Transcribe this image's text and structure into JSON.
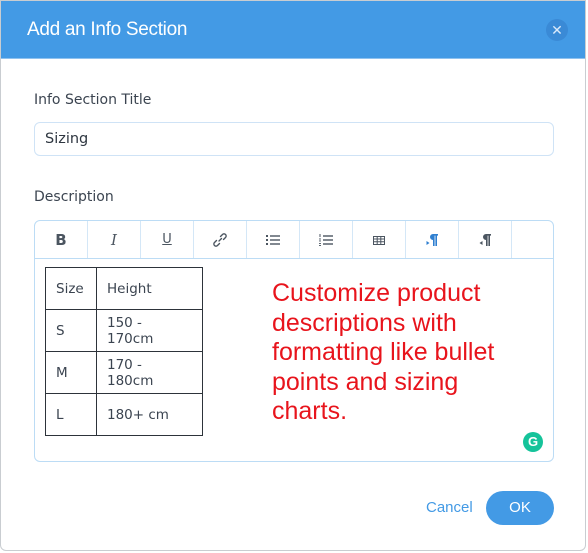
{
  "dialog": {
    "title": "Add an Info Section",
    "close_icon": "close-icon"
  },
  "form": {
    "title_label": "Info Section Title",
    "title_value": "Sizing",
    "description_label": "Description"
  },
  "toolbar": {
    "buttons": [
      {
        "name": "bold",
        "icon": "bold-icon"
      },
      {
        "name": "italic",
        "icon": "italic-icon"
      },
      {
        "name": "underline",
        "icon": "underline-icon"
      },
      {
        "name": "link",
        "icon": "link-icon"
      },
      {
        "name": "bulleted-list",
        "icon": "bullet-list-icon"
      },
      {
        "name": "numbered-list",
        "icon": "numbered-list-icon"
      },
      {
        "name": "table",
        "icon": "table-icon"
      },
      {
        "name": "text-direction-ltr",
        "icon": "ltr-paragraph-icon"
      },
      {
        "name": "text-direction-rtl",
        "icon": "rtl-paragraph-icon"
      }
    ],
    "bold_glyph": "B",
    "italic_glyph": "I",
    "underline_glyph": "U"
  },
  "size_table": {
    "headers": [
      "Size",
      "Height"
    ],
    "rows": [
      [
        "S",
        "150 - 170cm"
      ],
      [
        "M",
        "170 - 180cm"
      ],
      [
        "L",
        "180+ cm"
      ]
    ]
  },
  "annotation": "Customize product descriptions with formatting like bullet points and sizing charts.",
  "grammarly_glyph": "G",
  "footer": {
    "cancel_label": "Cancel",
    "ok_label": "OK"
  },
  "colors": {
    "accent": "#439ae5",
    "annotation": "#e8141c",
    "grammarly": "#15c39a"
  }
}
